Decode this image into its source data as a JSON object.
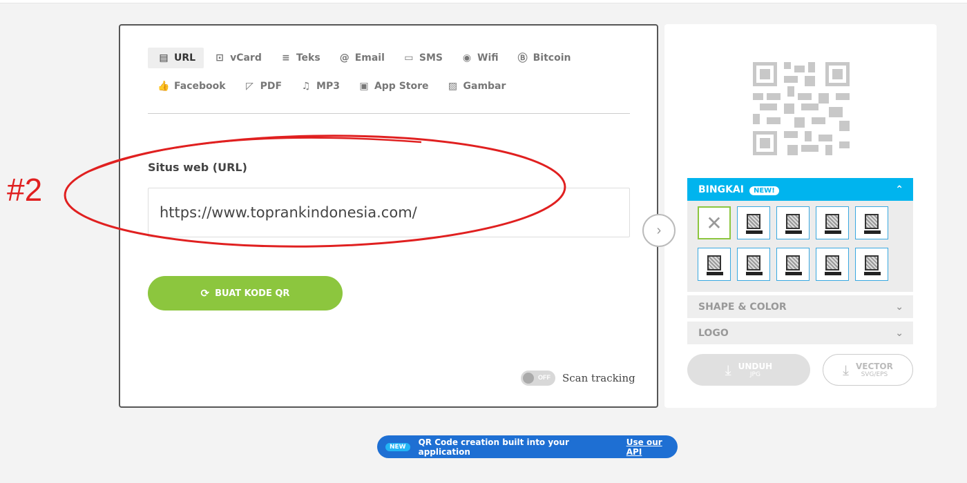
{
  "annotation": {
    "label": "#2",
    "color": "#e02020"
  },
  "tabs": {
    "row1": [
      {
        "label": "URL",
        "icon": "url-icon",
        "glyph": "▤",
        "active": true
      },
      {
        "label": "vCard",
        "icon": "vcard-icon",
        "glyph": "⊡"
      },
      {
        "label": "Teks",
        "icon": "text-icon",
        "glyph": "≡"
      },
      {
        "label": "Email",
        "icon": "at-icon",
        "glyph": "@"
      },
      {
        "label": "SMS",
        "icon": "message-icon",
        "glyph": "▭"
      },
      {
        "label": "Wifi",
        "icon": "wifi-icon",
        "glyph": "◉"
      },
      {
        "label": "Bitcoin",
        "icon": "bitcoin-icon",
        "glyph": "Ⓑ"
      }
    ],
    "row2": [
      {
        "label": "Facebook",
        "icon": "thumbs-up-icon",
        "glyph": "👍"
      },
      {
        "label": "PDF",
        "icon": "pdf-icon",
        "glyph": "◸"
      },
      {
        "label": "MP3",
        "icon": "music-icon",
        "glyph": "♫"
      },
      {
        "label": "App Store",
        "icon": "app-store-icon",
        "glyph": "▣"
      },
      {
        "label": "Gambar",
        "icon": "image-icon",
        "glyph": "▨"
      }
    ]
  },
  "form": {
    "url_label": "Situs web (URL)",
    "url_value": "https://www.toprankindonesia.com/",
    "generate_label": "BUAT KODE QR"
  },
  "scan_tracking": {
    "state": "OFF",
    "label": "Scan tracking"
  },
  "side": {
    "bingkai": {
      "title": "BINGKAI",
      "badge": "NEW!"
    },
    "shape": {
      "title": "SHAPE & COLOR"
    },
    "logo": {
      "title": "LOGO"
    },
    "download_jpg": {
      "title": "UNDUH",
      "sub": "JPG"
    },
    "download_vector": {
      "title": "VECTOR",
      "sub": "SVG/EPS"
    }
  },
  "api": {
    "badge": "NEW",
    "text": "QR Code creation built into your application",
    "link": "Use our API"
  },
  "colors": {
    "accent_green": "#8cc63e",
    "accent_blue": "#00b4ee",
    "api_blue": "#1e6fd3"
  }
}
